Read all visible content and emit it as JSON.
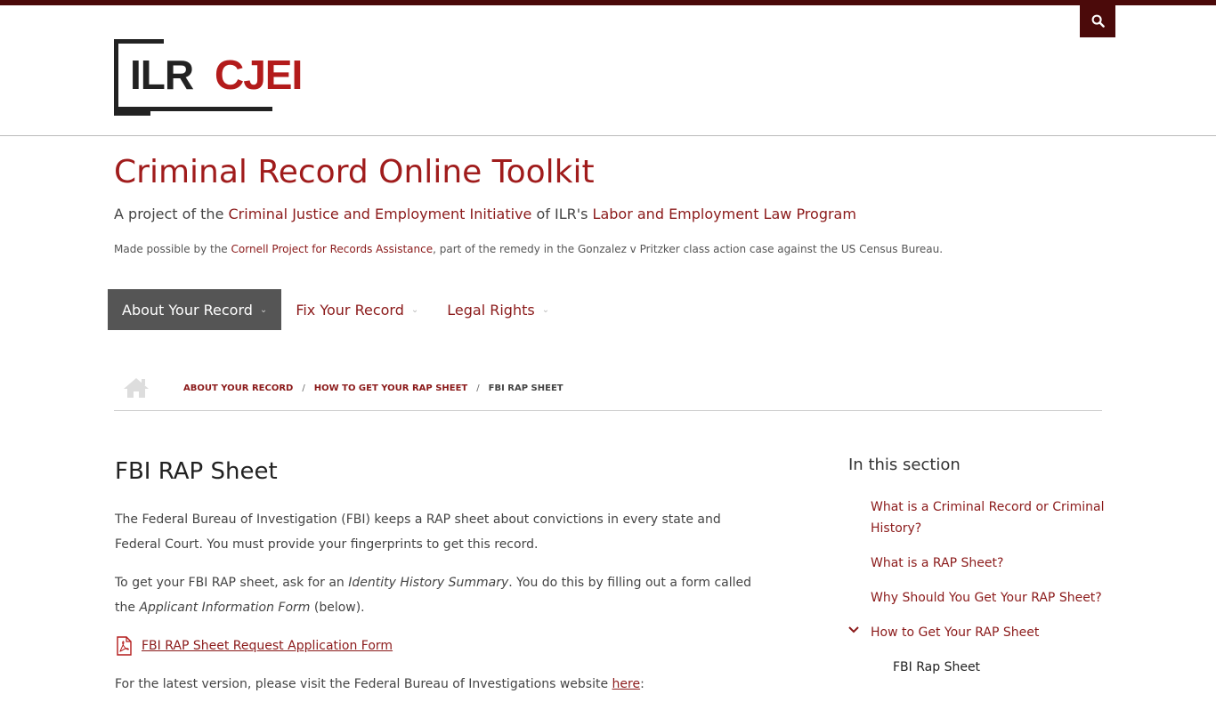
{
  "header": {
    "logo_left": "ILR",
    "logo_right": "CJEI",
    "search_icon": "search-icon"
  },
  "site": {
    "title": "Criminal Record Online Toolkit",
    "tagline_pre": "A project of the ",
    "tagline_link1": "Criminal Justice and Employment Initiative",
    "tagline_mid": " of ILR's ",
    "tagline_link2": "Labor and Employment Law Program",
    "credit_pre": "Made possible by the ",
    "credit_link": "Cornell Project for Records Assistance",
    "credit_post": ", part of the remedy in the Gonzalez v Pritzker class action case against the US Census Bureau."
  },
  "nav": {
    "items": [
      {
        "label": "About Your Record",
        "active": true
      },
      {
        "label": "Fix Your Record",
        "active": false
      },
      {
        "label": "Legal Rights",
        "active": false
      }
    ]
  },
  "breadcrumb": {
    "home_icon": "home-icon",
    "items": [
      "About Your Record",
      "How to Get Your RAP Sheet"
    ],
    "current": "FBI RAP Sheet"
  },
  "main": {
    "title": "FBI RAP Sheet",
    "p1": "The Federal Bureau of Investigation (FBI) keeps a RAP sheet about convictions in every state and Federal Court. You must provide your fingerprints to get this record.",
    "p2_pre": "To get your FBI RAP sheet, ask for an ",
    "p2_em1": "Identity History Summary",
    "p2_mid": ". You do this by filling out a form called the ",
    "p2_em2": "Applicant Information Form",
    "p2_post": " (below).",
    "pdf_link": "FBI RAP Sheet Request Application Form",
    "p3_pre": "For the latest version, please visit the Federal Bureau of Investigations website ",
    "p3_link": "here",
    "p3_post": ":"
  },
  "sidebar": {
    "heading": "In this section",
    "items": [
      "What is a Criminal Record or Criminal History?",
      "What is a RAP Sheet?",
      "Why Should You Get Your RAP Sheet?",
      "How to Get Your RAP Sheet"
    ],
    "sub_item": "FBI Rap Sheet"
  },
  "colors": {
    "brand_dark": "#4b0a0a",
    "link": "#8b1a1a",
    "title": "#a01c1c"
  }
}
